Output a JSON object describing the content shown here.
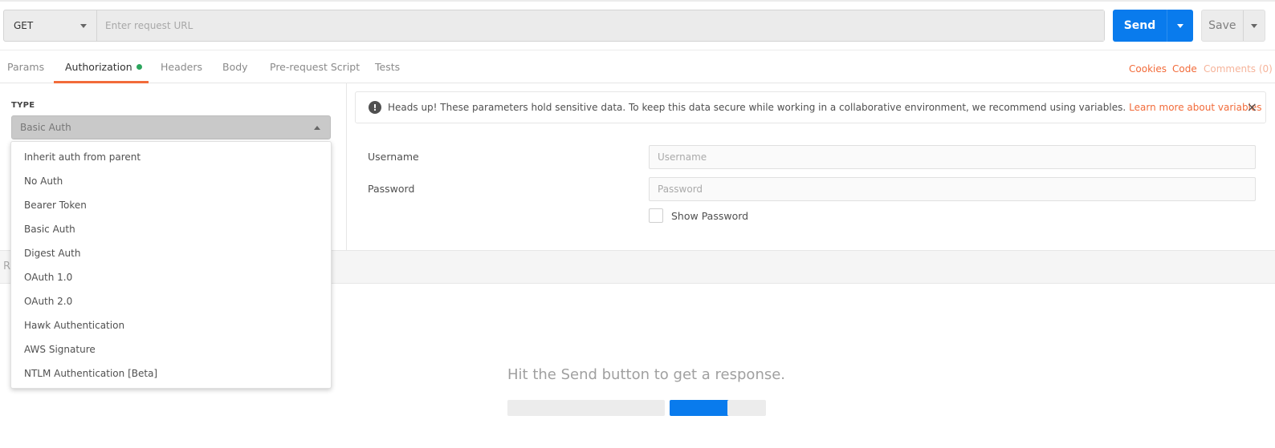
{
  "request": {
    "method": "GET",
    "url_value": "",
    "url_placeholder": "Enter request URL",
    "send_label": "Send",
    "save_label": "Save"
  },
  "tabs": [
    {
      "label": "Params",
      "active": false
    },
    {
      "label": "Authorization",
      "active": true,
      "indicator": "green-dot"
    },
    {
      "label": "Headers",
      "active": false
    },
    {
      "label": "Body",
      "active": false
    },
    {
      "label": "Pre-request Script",
      "active": false
    },
    {
      "label": "Tests",
      "active": false
    }
  ],
  "right_links": {
    "cookies": "Cookies",
    "code": "Code",
    "comments": "Comments (0)"
  },
  "auth": {
    "type_label": "TYPE",
    "selected": "Basic Auth",
    "options": [
      "Inherit auth from parent",
      "No Auth",
      "Bearer Token",
      "Basic Auth",
      "Digest Auth",
      "OAuth 1.0",
      "OAuth 2.0",
      "Hawk Authentication",
      "AWS Signature",
      "NTLM Authentication [Beta]"
    ]
  },
  "banner": {
    "icon": "exclamation-icon",
    "text": "Heads up! These parameters hold sensitive data. To keep this data secure while working in a collaborative environment, we recommend using variables.",
    "link": "Learn more about variables",
    "close": "×"
  },
  "fields": {
    "username_label": "Username",
    "username_placeholder": "Username",
    "password_label": "Password",
    "password_placeholder": "Password",
    "show_password_label": "Show Password"
  },
  "response": {
    "bar_label": "R",
    "empty_message": "Hit the Send button to get a response."
  },
  "colors": {
    "accent": "#f26b3a",
    "send": "#097bed",
    "indicator": "#2ba55d"
  }
}
